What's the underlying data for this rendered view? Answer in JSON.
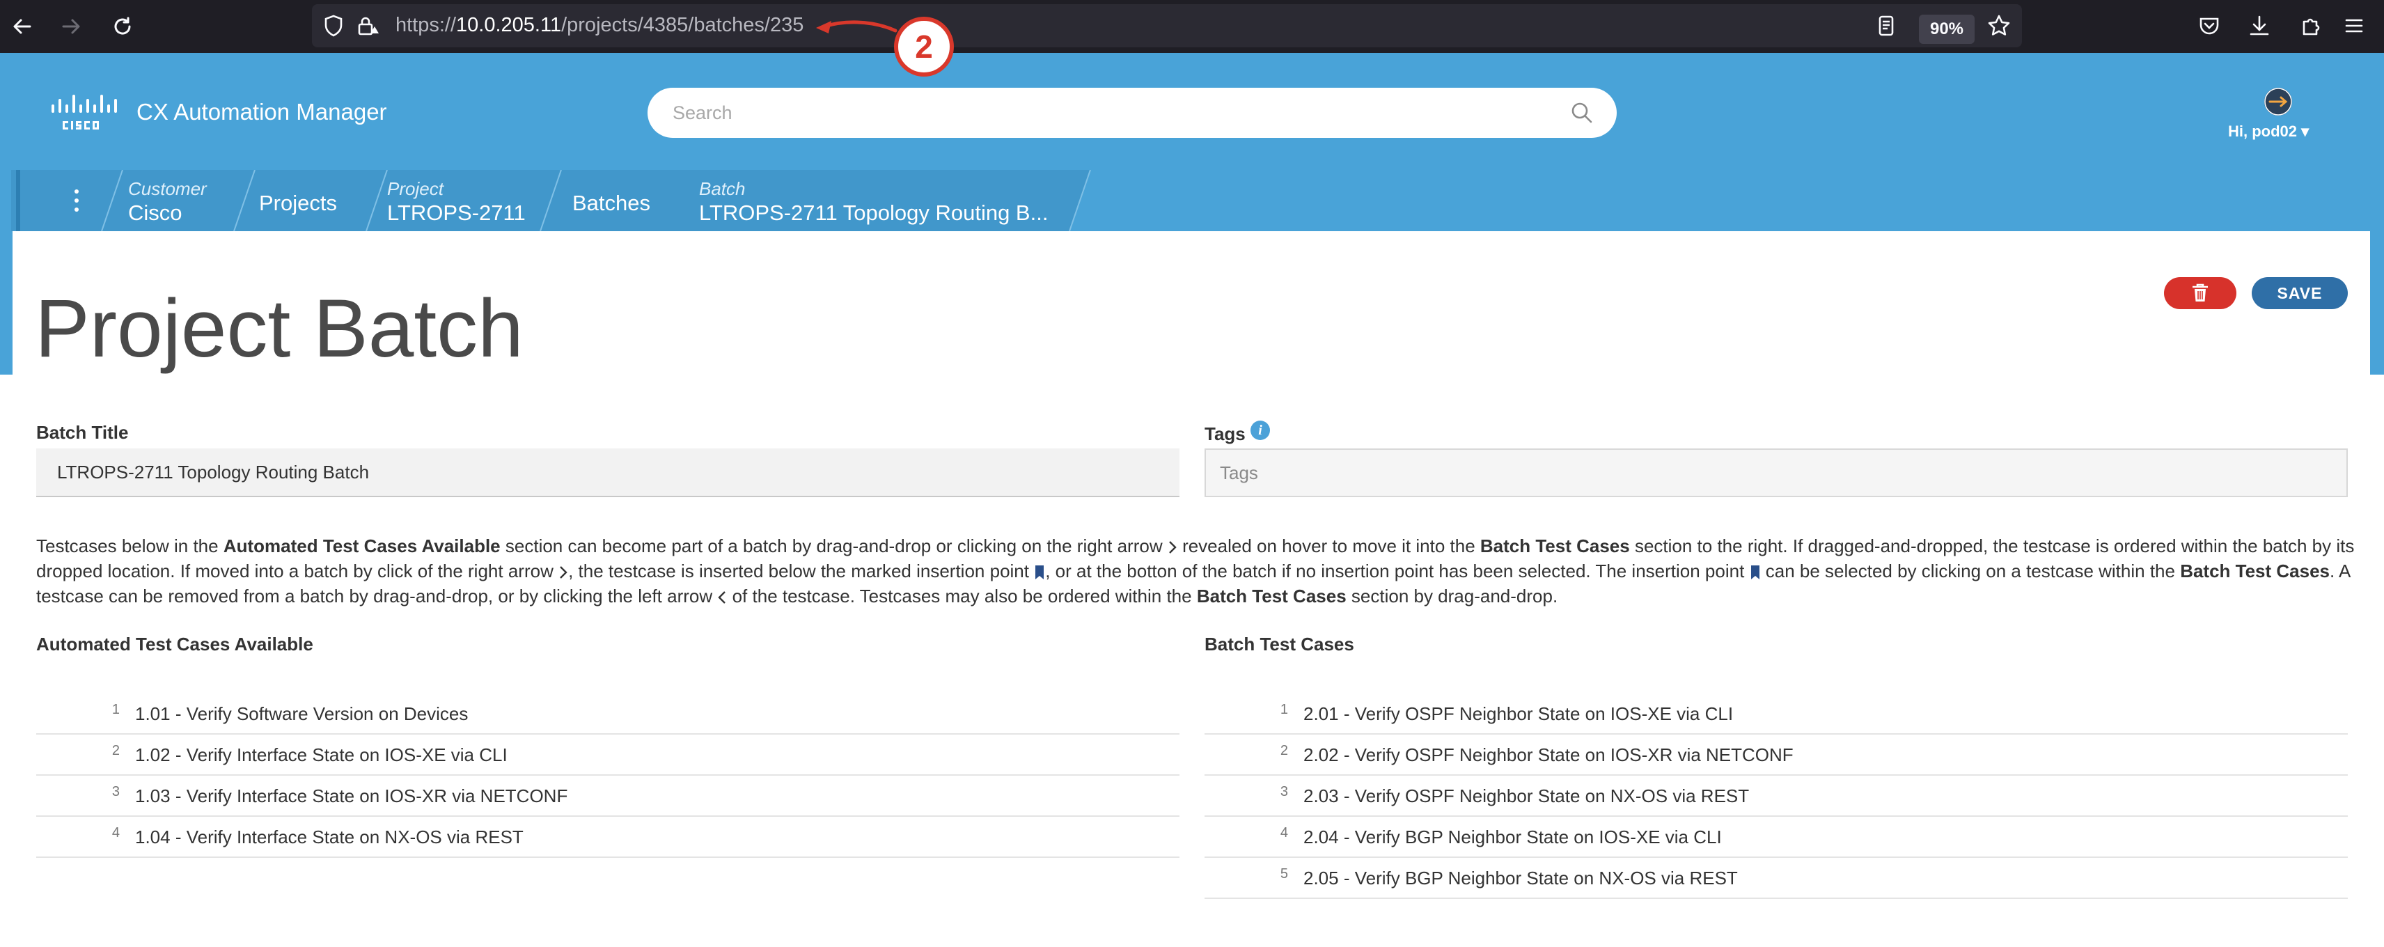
{
  "browser": {
    "url_prefix": "https://",
    "url_host": "10.0.205.11",
    "url_path": "/projects/4385/batches/235",
    "zoom": "90%"
  },
  "annotation": {
    "label": "2",
    "color": "#d9382b"
  },
  "header": {
    "app_title": "CX Automation Manager",
    "search_placeholder": "Search",
    "user_greeting": "Hi, pod02 ▾",
    "accent_color": "#49a3d8"
  },
  "breadcrumb": {
    "customer_label": "Customer",
    "customer_value": "Cisco",
    "projects": "Projects",
    "project_label": "Project",
    "project_value": "LTROPS-2711",
    "batches": "Batches",
    "batch_label": "Batch",
    "batch_value": "LTROPS-2711 Topology Routing B..."
  },
  "page": {
    "title": "Project Batch",
    "save_label": "SAVE"
  },
  "form": {
    "batch_title_label": "Batch Title",
    "batch_title_value": "LTROPS-2711 Topology Routing Batch",
    "tags_label": "Tags",
    "tags_placeholder": "Tags"
  },
  "instructions": {
    "p1": "Testcases below in the ",
    "b1": "Automated Test Cases Available",
    "p2": " section can become part of a batch by drag-and-drop or clicking on the right arrow ",
    "p3": " revealed on hover to move it into the ",
    "b2": "Batch Test Cases",
    "p4": " section to the right. If dragged-and-dropped, the testcase is ordered within the batch by its dropped location. If moved into a batch by click of the right arrow ",
    "p5": ", the testcase is inserted below the marked insertion point ",
    "p6": ", or at the botton of the batch if no insertion point has been selected. The insertion point ",
    "p7": " can be selected by clicking on a testcase within the ",
    "b3": "Batch Test Cases",
    "p8": ". A testcase can be removed from a batch by drag-and-drop, or by clicking the left arrow ",
    "p9": " of the testcase. Testcases may also be ordered within the ",
    "b4": "Batch Test Cases",
    "p10": " section by drag-and-drop."
  },
  "available": {
    "title": "Automated Test Cases Available",
    "items": [
      {
        "num": "1",
        "label": "1.01 - Verify Software Version on Devices"
      },
      {
        "num": "2",
        "label": "1.02 - Verify Interface State on IOS-XE via CLI"
      },
      {
        "num": "3",
        "label": "1.03 - Verify Interface State on IOS-XR via NETCONF"
      },
      {
        "num": "4",
        "label": "1.04 - Verify Interface State on NX-OS via REST"
      }
    ]
  },
  "batch": {
    "title": "Batch Test Cases",
    "items": [
      {
        "num": "1",
        "label": "2.01 - Verify OSPF Neighbor State on IOS-XE via CLI"
      },
      {
        "num": "2",
        "label": "2.02 - Verify OSPF Neighbor State on IOS-XR via NETCONF"
      },
      {
        "num": "3",
        "label": "2.03 - Verify OSPF Neighbor State on NX-OS via REST"
      },
      {
        "num": "4",
        "label": "2.04 - Verify BGP Neighbor State on IOS-XE via CLI"
      },
      {
        "num": "5",
        "label": "2.05 - Verify BGP Neighbor State on NX-OS via REST"
      }
    ]
  }
}
